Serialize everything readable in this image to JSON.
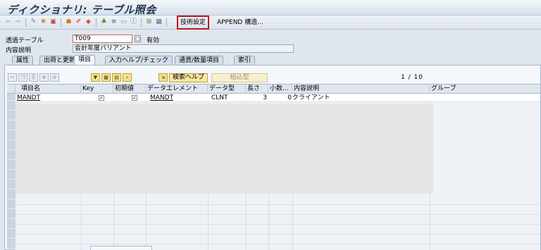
{
  "window": {
    "title": "ディクショナリ: テーブル照会"
  },
  "toolbar": {
    "tech_settings": "技術設定",
    "append_structure": "APPEND 構造..."
  },
  "form": {
    "table_label": "透過テーブル",
    "table_value": "T009",
    "status": "有効",
    "desc_label": "内容説明",
    "desc_value": "会計年度バリアント"
  },
  "tabs": [
    "属性",
    "出荷と更新",
    "項目",
    "入力ヘルプ/チェック",
    "通貨/数量項目",
    "索引"
  ],
  "panel": {
    "search_help": "検索ヘルプ",
    "built_in_type": "組込型",
    "pager": "1 / 10"
  },
  "grid": {
    "headers": [
      "項目名",
      "Key",
      "初期値",
      "データエレメント",
      "データ型",
      "長さ",
      "小数...",
      "内容説明",
      "グループ"
    ],
    "rows": [
      {
        "field": "MANDT",
        "key": true,
        "initial": true,
        "element": "MANDT",
        "type": "CLNT",
        "length": "3",
        "decimals": "0",
        "description": "クライアント",
        "group": ""
      }
    ]
  },
  "colors": {
    "highlight": "#c0121c",
    "title": "#1f3550",
    "grid_bg": "#eef2f7"
  }
}
